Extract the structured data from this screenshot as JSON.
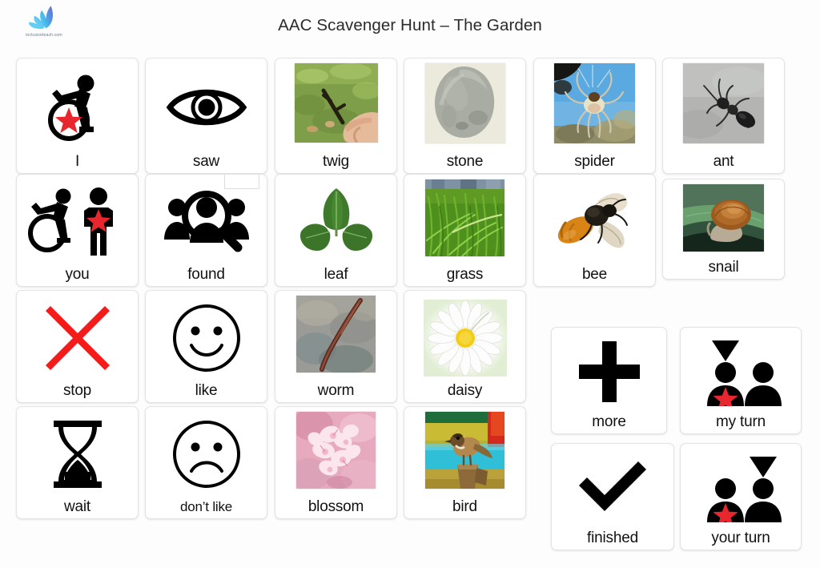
{
  "header": {
    "title": "AAC Scavenger Hunt – The Garden",
    "logo_wordmark": "inclusiveteach.com",
    "logo_icon": "leaf-flame-logo"
  },
  "colors": {
    "star_red": "#e8262d",
    "stop_red": "#f41b1b",
    "symbol_black": "#000000",
    "card_border": "#e3e3e3",
    "card_bg": "#ffffff",
    "page_bg": "#ffffff",
    "title_text": "#2b2b2b",
    "label_text": "#111111",
    "logo_blue": "#2aa8e0",
    "logo_violet": "#4f3fae",
    "daisy_yellow": "#f2cc17",
    "bee_orange": "#d98416",
    "blossom_pink": "#e9a8bd",
    "grass_green": "#63a821",
    "bird_cyan": "#2fbfd6"
  },
  "grid": {
    "columns": 6,
    "rows": 4
  },
  "cards": [
    {
      "id": "i",
      "label": "I",
      "art": "wheelchair-user-star",
      "kind": "symbol",
      "row": 1,
      "col": 1
    },
    {
      "id": "saw",
      "label": "saw",
      "art": "eye",
      "kind": "symbol",
      "row": 1,
      "col": 2
    },
    {
      "id": "twig",
      "label": "twig",
      "art": "twig-in-hand-photo",
      "kind": "photo",
      "row": 1,
      "col": 3
    },
    {
      "id": "stone",
      "label": "stone",
      "art": "grey-stone-photo",
      "kind": "photo",
      "row": 1,
      "col": 4
    },
    {
      "id": "spider",
      "label": "spider",
      "art": "spider-on-web-photo",
      "kind": "photo",
      "row": 1,
      "col": 5
    },
    {
      "id": "ant",
      "label": "ant",
      "art": "black-ant-photo",
      "kind": "photo",
      "row": 1,
      "col": 6
    },
    {
      "id": "you",
      "label": "you",
      "art": "wheelchair-pointing-person-star",
      "kind": "symbol",
      "row": 2,
      "col": 1
    },
    {
      "id": "found",
      "label": "found",
      "art": "people-magnifying-glass",
      "kind": "symbol",
      "row": 2,
      "col": 2
    },
    {
      "id": "leaf",
      "label": "leaf",
      "art": "green-leaf-photo",
      "kind": "photo",
      "row": 2,
      "col": 3
    },
    {
      "id": "grass",
      "label": "grass",
      "art": "green-grass-photo",
      "kind": "photo",
      "row": 2,
      "col": 4
    },
    {
      "id": "bee",
      "label": "bee",
      "art": "honey-bee-photo",
      "kind": "photo",
      "row": 2,
      "col": 5
    },
    {
      "id": "snail",
      "label": "snail",
      "art": "snail-on-leaf-photo",
      "kind": "photo",
      "row": 2,
      "col": 6
    },
    {
      "id": "stop",
      "label": "stop",
      "art": "red-cross",
      "kind": "symbol",
      "row": 3,
      "col": 1
    },
    {
      "id": "like",
      "label": "like",
      "art": "happy-face",
      "kind": "symbol",
      "row": 3,
      "col": 2
    },
    {
      "id": "worm",
      "label": "worm",
      "art": "earthworm-photo",
      "kind": "photo",
      "row": 3,
      "col": 3
    },
    {
      "id": "daisy",
      "label": "daisy",
      "art": "white-daisy-photo",
      "kind": "photo",
      "row": 3,
      "col": 4
    },
    {
      "id": "wait",
      "label": "wait",
      "art": "hourglass",
      "kind": "symbol",
      "row": 4,
      "col": 1
    },
    {
      "id": "dont-like",
      "label": "don’t like",
      "art": "sad-face",
      "kind": "symbol",
      "row": 4,
      "col": 2
    },
    {
      "id": "blossom",
      "label": "blossom",
      "art": "pink-blossom-photo",
      "kind": "photo",
      "row": 4,
      "col": 3
    },
    {
      "id": "bird",
      "label": "bird",
      "art": "sparrow-on-post-photo",
      "kind": "photo",
      "row": 4,
      "col": 4
    }
  ],
  "side_cards": [
    {
      "id": "more",
      "label": "more",
      "art": "plus-sign",
      "kind": "symbol"
    },
    {
      "id": "my-turn",
      "label": "my turn",
      "art": "two-people-arrow-left",
      "kind": "symbol"
    },
    {
      "id": "finished",
      "label": "finished",
      "art": "check-mark",
      "kind": "symbol"
    },
    {
      "id": "your-turn",
      "label": "your turn",
      "art": "two-people-arrow-right",
      "kind": "symbol"
    }
  ]
}
